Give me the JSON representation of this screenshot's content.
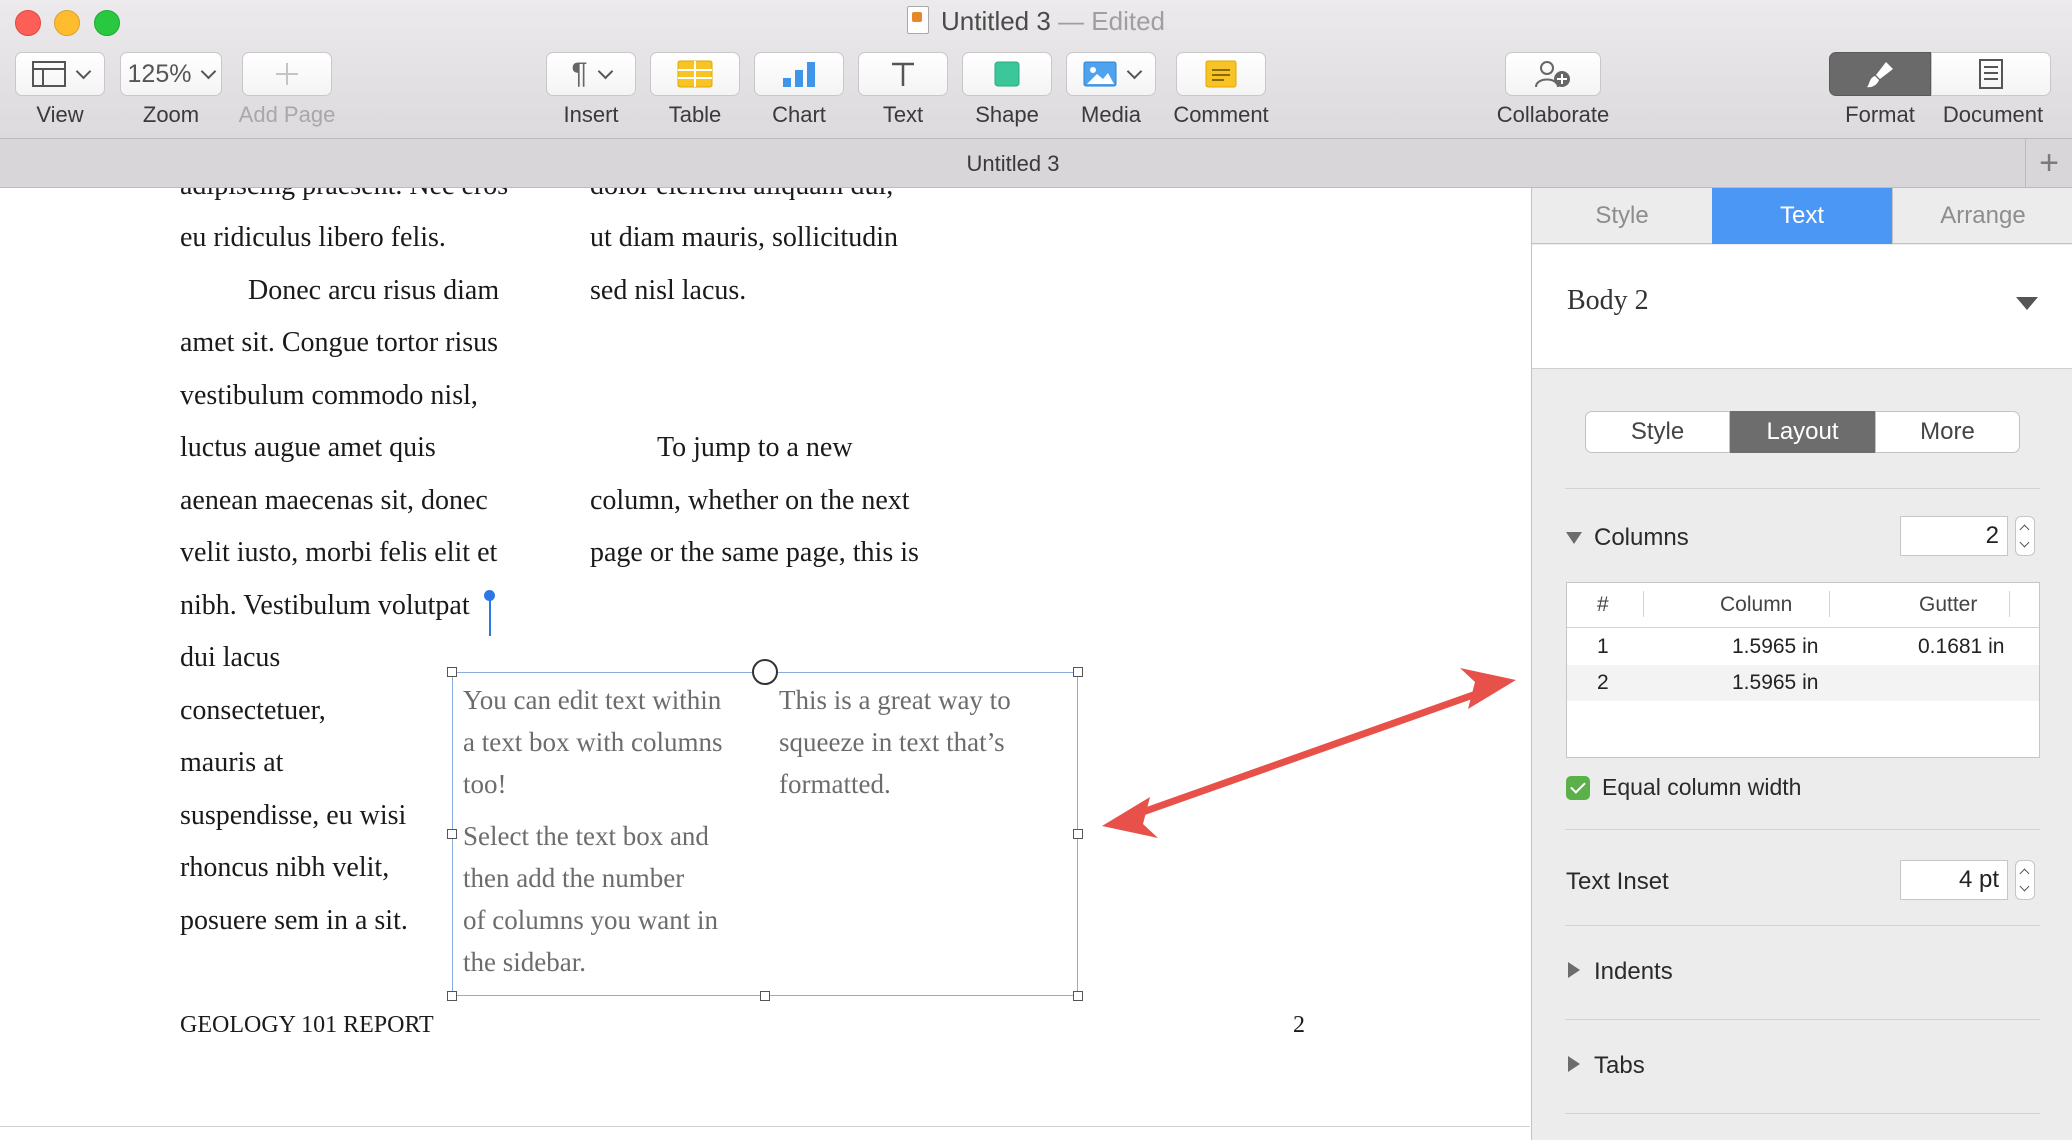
{
  "window": {
    "title": "Untitled 3",
    "status": "— Edited"
  },
  "toolbar": {
    "view": {
      "label": "View"
    },
    "zoom": {
      "value": "125%",
      "label": "Zoom"
    },
    "add_page": {
      "label": "Add Page"
    },
    "insert": {
      "label": "Insert"
    },
    "table": {
      "label": "Table"
    },
    "chart": {
      "label": "Chart"
    },
    "text": {
      "label": "Text"
    },
    "shape": {
      "label": "Shape"
    },
    "media": {
      "label": "Media"
    },
    "comment": {
      "label": "Comment"
    },
    "collaborate": {
      "label": "Collaborate"
    },
    "format": {
      "label": "Format"
    },
    "document": {
      "label": "Document"
    }
  },
  "tab": {
    "title": "Untitled 3",
    "add": "+"
  },
  "document": {
    "col1": [
      "adipiscing praesent. Nec eros",
      "eu ridiculus libero felis.",
      "Donec arcu risus diam",
      "amet sit. Congue tortor risus",
      "vestibulum commodo nisl,",
      "luctus augue amet quis",
      "aenean maecenas sit, donec",
      "velit iusto, morbi felis elit et",
      "nibh. Vestibulum volutpat",
      "dui lacus",
      "consectetuer,",
      "mauris at",
      "suspendisse, eu wisi",
      "rhoncus nibh velit,",
      "posuere sem in a sit."
    ],
    "col2": [
      "dolor eleifend aliquam dui,",
      "ut diam mauris, sollicitudin",
      "sed nisl lacus.",
      "To jump to a new",
      "column, whether on the next",
      "page or the same page, this is"
    ],
    "textbox": {
      "col1": [
        "You can edit text within",
        "a text box with columns",
        "too!",
        "Select the text box and",
        "then add the number",
        "of columns you want in",
        "the sidebar."
      ],
      "col2": [
        "This is a great way to",
        "squeeze in text that’s",
        "formatted."
      ]
    },
    "footer_left": "GEOLOGY 101 REPORT",
    "footer_right": "2"
  },
  "inspector": {
    "tabs": [
      "Style",
      "Text",
      "Arrange"
    ],
    "paragraph_style": "Body 2",
    "segments": [
      "Style",
      "Layout",
      "More"
    ],
    "columns": {
      "label": "Columns",
      "value": "2",
      "headers": [
        "#",
        "Column",
        "Gutter"
      ],
      "rows": [
        {
          "num": "1",
          "width": "1.5965 in",
          "gutter": "0.1681 in"
        },
        {
          "num": "2",
          "width": "1.5965 in",
          "gutter": ""
        }
      ]
    },
    "equal_width": "Equal column width",
    "text_inset": {
      "label": "Text Inset",
      "value": "4 pt"
    },
    "indents": "Indents",
    "tabs_section": "Tabs"
  },
  "colors": {
    "accent": "#4b97f6",
    "annotation_arrow": "#e8504a",
    "check_green": "#5bb04a"
  }
}
